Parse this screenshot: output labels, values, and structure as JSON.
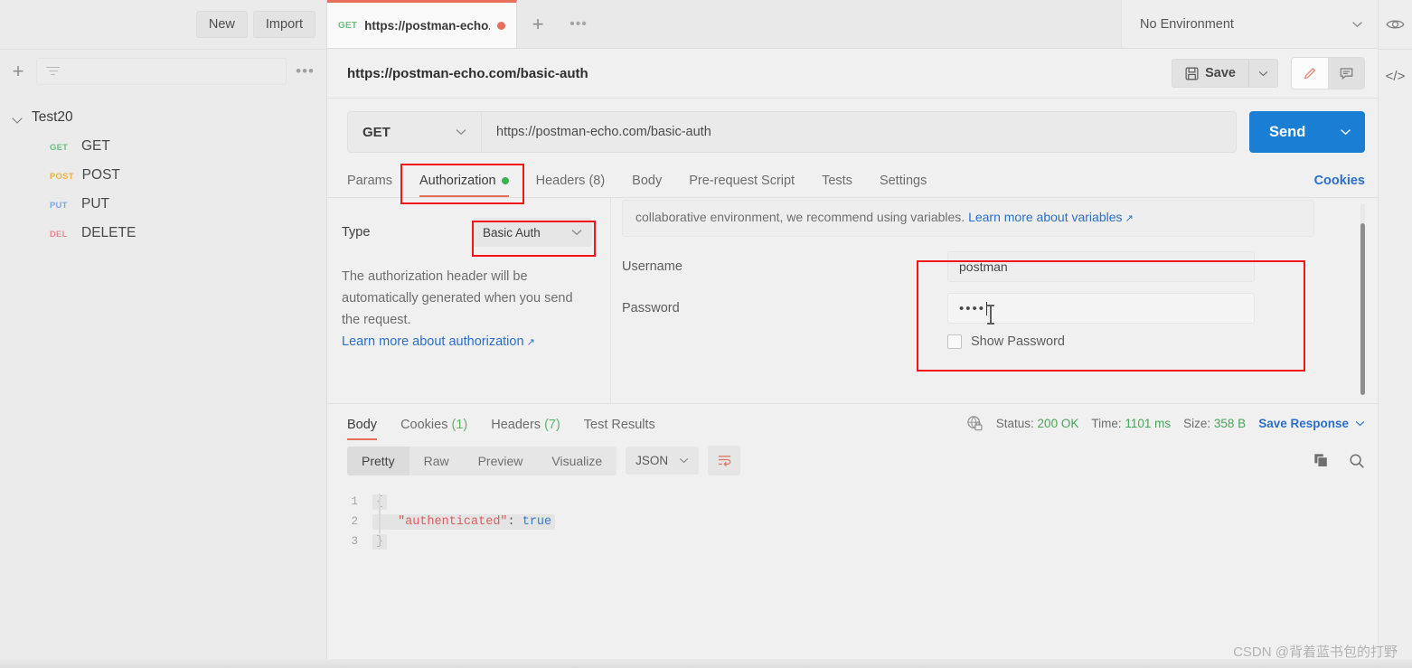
{
  "sidebar": {
    "new_button": "New",
    "import_button": "Import",
    "filter_placeholder": "",
    "more_actions": "•••",
    "collection": {
      "name": "Test20",
      "requests": [
        {
          "method": "GET",
          "label": "GET",
          "color": "#6bc07b"
        },
        {
          "method": "POST",
          "label": "POST",
          "color": "#e8b24a"
        },
        {
          "method": "PUT",
          "label": "PUT",
          "color": "#79a9e0"
        },
        {
          "method": "DEL",
          "label": "DELETE",
          "color": "#e98a92"
        }
      ]
    }
  },
  "tabstrip": {
    "tabs": [
      {
        "method": "GET",
        "title": "https://postman-echo.",
        "unsaved": true
      }
    ],
    "new_tab": "+",
    "tab_menu": "•••"
  },
  "environment": {
    "selected": "No Environment",
    "eye_icon": "eye-icon"
  },
  "header": {
    "breadcrumb": "https://postman-echo.com/basic-auth",
    "save_label": "Save",
    "save_icon": "floppy-disk-icon",
    "caret_icon": "chevron-down-icon",
    "edit_icon": "pencil-icon",
    "comment_icon": "comment-icon",
    "code_icon": "</>"
  },
  "request": {
    "method": "GET",
    "url": "https://postman-echo.com/basic-auth",
    "send_label": "Send",
    "tabs": [
      {
        "label": "Params",
        "active": false,
        "dot": false
      },
      {
        "label": "Authorization",
        "active": true,
        "dot": true
      },
      {
        "label": "Headers (8)",
        "active": false,
        "dot": false
      },
      {
        "label": "Body",
        "active": false,
        "dot": false
      },
      {
        "label": "Pre-request Script",
        "active": false,
        "dot": false
      },
      {
        "label": "Tests",
        "active": false,
        "dot": false
      },
      {
        "label": "Settings",
        "active": false,
        "dot": false
      }
    ],
    "cookies_link": "Cookies"
  },
  "authorization": {
    "type_label": "Type",
    "type_value": "Basic Auth",
    "description": "The authorization header will be automatically generated when you send the request.",
    "learn_more": "Learn more about authorization",
    "variable_note": "collaborative environment, we recommend using variables.",
    "variable_note_link": "Learn more about variables",
    "username_label": "Username",
    "username_value": "postman",
    "password_label": "Password",
    "password_value": "••••",
    "show_password_label": "Show Password",
    "show_password_checked": false
  },
  "response": {
    "tabs": [
      {
        "label": "Body",
        "count": "",
        "active": true
      },
      {
        "label": "Cookies",
        "count": "(1)",
        "active": false
      },
      {
        "label": "Headers",
        "count": "(7)",
        "active": false
      },
      {
        "label": "Test Results",
        "count": "",
        "active": false
      }
    ],
    "status_label": "Status:",
    "status_value": "200 OK",
    "time_label": "Time:",
    "time_value": "1101 ms",
    "size_label": "Size:",
    "size_value": "358 B",
    "save_response": "Save Response",
    "lock_icon": "globe-lock-icon",
    "view_modes": [
      {
        "label": "Pretty",
        "active": true
      },
      {
        "label": "Raw",
        "active": false
      },
      {
        "label": "Preview",
        "active": false
      },
      {
        "label": "Visualize",
        "active": false
      }
    ],
    "format": "JSON",
    "wrap_icon": "word-wrap-icon",
    "copy_icon": "copy-icon",
    "search_icon": "search-icon",
    "body_lines": [
      {
        "num": "1",
        "tokens": [
          {
            "t": "brace",
            "v": "{"
          }
        ]
      },
      {
        "num": "2",
        "tokens": [
          {
            "t": "key",
            "v": "\"authenticated\""
          },
          {
            "t": "punc",
            "v": ": "
          },
          {
            "t": "bool",
            "v": "true"
          }
        ]
      },
      {
        "num": "3",
        "tokens": [
          {
            "t": "brace",
            "v": "}"
          }
        ]
      }
    ]
  },
  "annotations": {
    "highlight_color": "#f01616",
    "boxes": [
      "authorization-tab",
      "basic-auth-type",
      "credentials-fields"
    ]
  },
  "watermark": "CSDN @背着蓝书包的打野"
}
